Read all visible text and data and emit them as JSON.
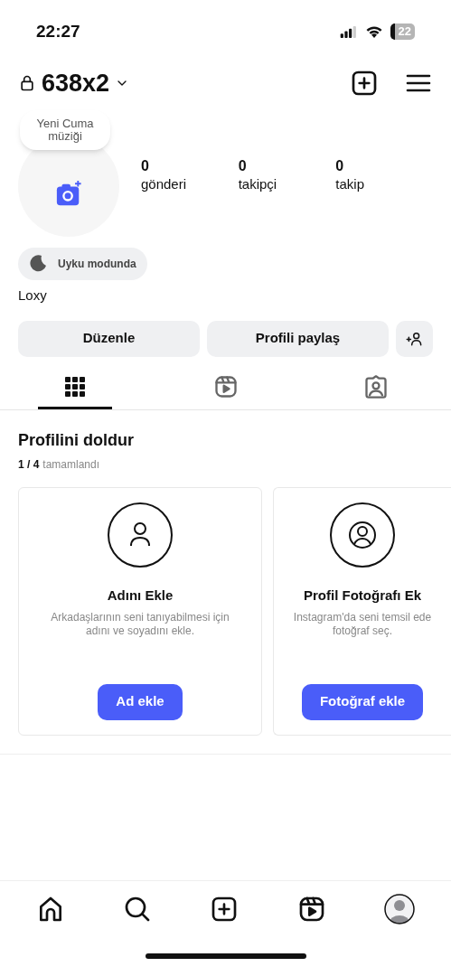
{
  "status_bar": {
    "time": "22:27",
    "battery": "22"
  },
  "header": {
    "username": "638x2"
  },
  "profile": {
    "note": "Yeni Cuma müziği",
    "stats": [
      {
        "value": "0",
        "label": "gönderi"
      },
      {
        "value": "0",
        "label": "takipçi"
      },
      {
        "value": "0",
        "label": "takip"
      }
    ],
    "status_chip": "Uyku modunda",
    "name": "Loxy"
  },
  "actions": [
    "Düzenle",
    "Profili paylaş"
  ],
  "tabs": [
    {
      "kind": "grid",
      "selected": true
    },
    {
      "kind": "reels",
      "selected": false
    },
    {
      "kind": "tagged",
      "selected": false
    }
  ],
  "complete_profile": {
    "title": "Profilini doldur",
    "progress": "1 / 4",
    "progress_label": "tamamlandı",
    "cards": [
      {
        "kind": "name",
        "title": "Adını Ekle",
        "text": "Arkadaşlarının seni tanıyabilmesi için adını ve soyadını ekle.",
        "button": "Ad ekle"
      },
      {
        "kind": "photo",
        "title": "Profil Fotoğrafı Ek",
        "text": "Instagram'da seni temsil ede fotoğraf seç.",
        "button": "Fotoğraf ekle"
      }
    ]
  }
}
